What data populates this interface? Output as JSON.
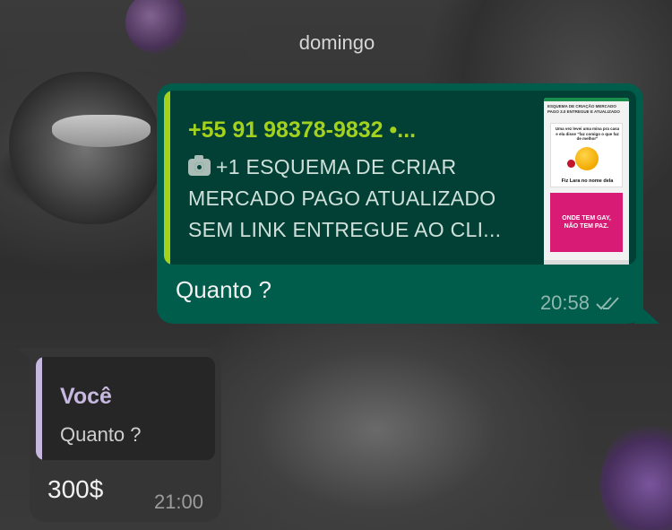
{
  "chat": {
    "date_separator": "domingo",
    "messages": [
      {
        "direction": "outgoing",
        "quoted": {
          "sender": "+55 91 98378-9832 •...",
          "media_icon": "camera-icon",
          "text": "+1 ESQUEMA DE CRIAR MERCADO PAGO ATUALIZADO SEM LINK ENTREGUE AO CLI...",
          "thumbnail": {
            "caption": "ESQUEMA DE CRIAÇÃO MERCADO PAGO 3.0 ENTREGUE E ATUALIZADO",
            "card_text": "Uma vez levei uma mina pra casa e ela disse \"faz comigo o que faz de melhor\"",
            "card_footer": "Fiz Lara no nome dela",
            "pink_text": "ONDE TEM GAY, NÃO TEM PAZ."
          }
        },
        "text": "Quanto ?",
        "time": "20:58",
        "status_icon": "double-check-icon"
      },
      {
        "direction": "incoming",
        "quoted": {
          "sender": "Você",
          "text": "Quanto ?"
        },
        "text": "300$",
        "time": "21:00"
      }
    ]
  },
  "colors": {
    "outgoing_bubble": "#005c4b",
    "outgoing_quote_accent": "#a3d11c",
    "incoming_bubble": "#353535",
    "incoming_quote_accent": "#c7b8e0"
  }
}
